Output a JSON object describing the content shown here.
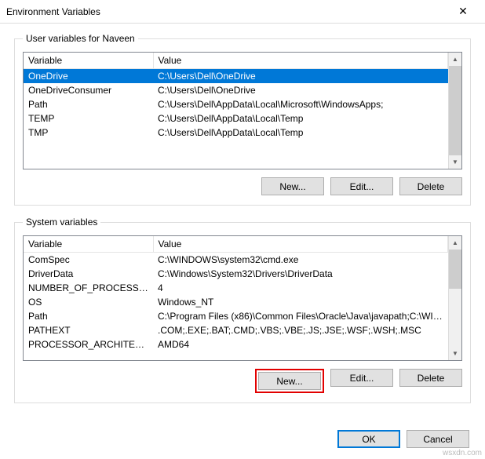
{
  "window": {
    "title": "Environment Variables",
    "close_glyph": "✕"
  },
  "user_section": {
    "legend": "User variables for Naveen",
    "columns": {
      "var": "Variable",
      "val": "Value"
    },
    "rows": [
      {
        "name": "OneDrive",
        "value": "C:\\Users\\Dell\\OneDrive",
        "selected": true
      },
      {
        "name": "OneDriveConsumer",
        "value": "C:\\Users\\Dell\\OneDrive"
      },
      {
        "name": "Path",
        "value": "C:\\Users\\Dell\\AppData\\Local\\Microsoft\\WindowsApps;"
      },
      {
        "name": "TEMP",
        "value": "C:\\Users\\Dell\\AppData\\Local\\Temp"
      },
      {
        "name": "TMP",
        "value": "C:\\Users\\Dell\\AppData\\Local\\Temp"
      }
    ],
    "buttons": {
      "new": "New...",
      "edit": "Edit...",
      "delete": "Delete"
    }
  },
  "system_section": {
    "legend": "System variables",
    "columns": {
      "var": "Variable",
      "val": "Value"
    },
    "rows": [
      {
        "name": "ComSpec",
        "value": "C:\\WINDOWS\\system32\\cmd.exe"
      },
      {
        "name": "DriverData",
        "value": "C:\\Windows\\System32\\Drivers\\DriverData"
      },
      {
        "name": "NUMBER_OF_PROCESSORS",
        "value": "4"
      },
      {
        "name": "OS",
        "value": "Windows_NT"
      },
      {
        "name": "Path",
        "value": "C:\\Program Files (x86)\\Common Files\\Oracle\\Java\\javapath;C:\\WIN..."
      },
      {
        "name": "PATHEXT",
        "value": ".COM;.EXE;.BAT;.CMD;.VBS;.VBE;.JS;.JSE;.WSF;.WSH;.MSC"
      },
      {
        "name": "PROCESSOR_ARCHITECTURE",
        "value": "AMD64"
      }
    ],
    "buttons": {
      "new": "New...",
      "edit": "Edit...",
      "delete": "Delete"
    }
  },
  "footer": {
    "ok": "OK",
    "cancel": "Cancel"
  },
  "watermark": "wsxdn.com",
  "glyphs": {
    "up": "▲",
    "down": "▼"
  }
}
